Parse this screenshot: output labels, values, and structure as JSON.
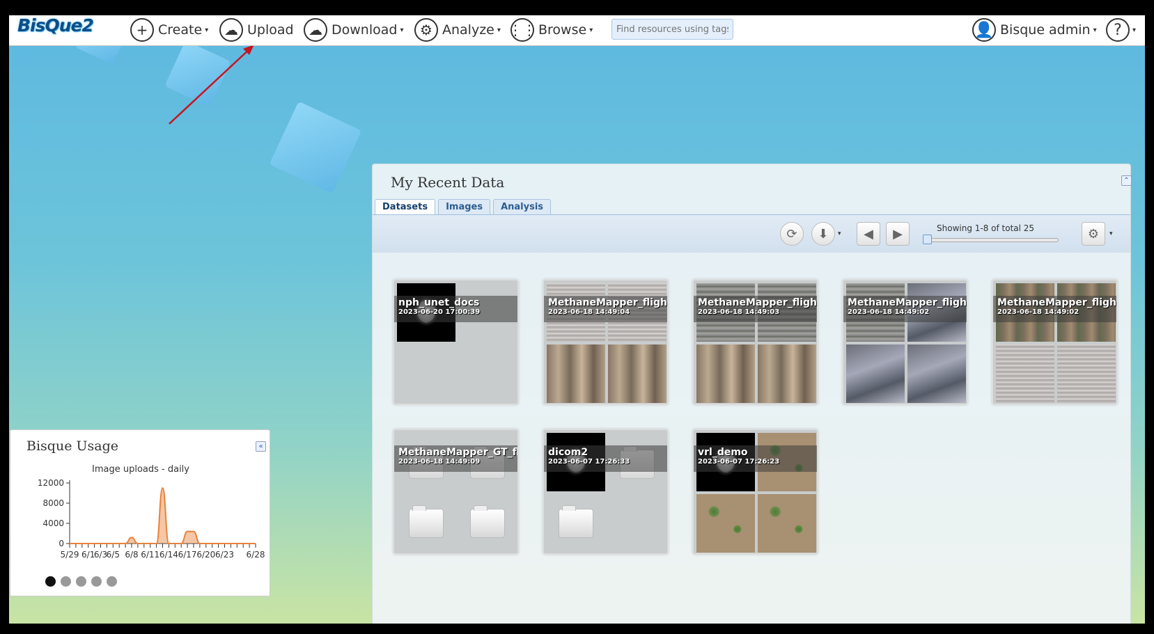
{
  "app": {
    "logo": "BisQue2"
  },
  "nav": {
    "create": "Create",
    "upload": "Upload",
    "download": "Download",
    "analyze": "Analyze",
    "browse": "Browse",
    "tag_search_placeholder": "Find resources using tags",
    "user": "Bisque admin",
    "help_icon": "?"
  },
  "recent": {
    "title": "My Recent Data",
    "tabs": [
      "Datasets",
      "Images",
      "Analysis"
    ],
    "active_tab": "Datasets",
    "showing": "Showing 1-8 of total 25",
    "items": [
      {
        "name": "nph_unet_docs",
        "date": "2023-06-20 17:00:39"
      },
      {
        "name": "MethaneMapper_flightl",
        "date": "2023-06-18 14:49:04"
      },
      {
        "name": "MethaneMapper_flightl",
        "date": "2023-06-18 14:49:03"
      },
      {
        "name": "MethaneMapper_flightl",
        "date": "2023-06-18 14:49:02"
      },
      {
        "name": "MethaneMapper_flightl",
        "date": "2023-06-18 14:49:02"
      },
      {
        "name": "MethaneMapper_GT_fli",
        "date": "2023-06-18 14:49:09"
      },
      {
        "name": "dicom2",
        "date": "2023-06-07 17:26:33"
      },
      {
        "name": "vrl_demo",
        "date": "2023-06-07 17:26:23"
      }
    ]
  },
  "usage": {
    "title": "Bisque Usage",
    "pages": 5,
    "active_page": 1
  },
  "chart_data": {
    "type": "area",
    "title": "Image uploads - daily",
    "xlabel": "",
    "ylabel": "",
    "ylim": [
      0,
      12000
    ],
    "yticks": [
      0,
      4000,
      8000,
      12000
    ],
    "xtick_labels": [
      "5/29",
      "6/1",
      "6/3",
      "6/5",
      "6/8",
      "6/11",
      "6/14",
      "6/17",
      "6/20",
      "6/23",
      "6/28"
    ],
    "x": [
      "5/29",
      "5/30",
      "5/31",
      "6/1",
      "6/2",
      "6/3",
      "6/4",
      "6/5",
      "6/6",
      "6/7",
      "6/8",
      "6/9",
      "6/10",
      "6/11",
      "6/12",
      "6/13",
      "6/14",
      "6/15",
      "6/16",
      "6/17",
      "6/18",
      "6/19",
      "6/20",
      "6/21",
      "6/22",
      "6/23",
      "6/24",
      "6/25",
      "6/26",
      "6/27",
      "6/28"
    ],
    "values": [
      0,
      0,
      0,
      0,
      0,
      0,
      0,
      0,
      0,
      0,
      1200,
      0,
      0,
      0,
      0,
      11000,
      0,
      0,
      0,
      2400,
      2400,
      0,
      0,
      0,
      0,
      0,
      0,
      0,
      0,
      0,
      0
    ],
    "color": "#e8823a",
    "grid": false
  }
}
